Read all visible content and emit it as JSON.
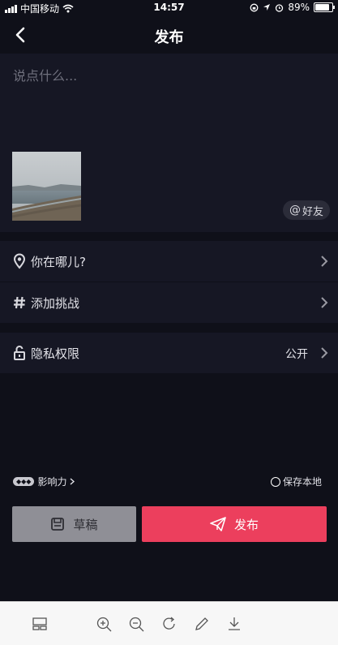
{
  "status_bar": {
    "carrier": "中国移动",
    "time": "14:57",
    "battery": "89%"
  },
  "header": {
    "title": "发布"
  },
  "compose": {
    "placeholder": "说点什么...",
    "mention_label": "好友"
  },
  "options": {
    "location_label": "你在哪儿?",
    "challenge_label": "添加挑战",
    "privacy_label": "隐私权限",
    "privacy_value": "公开"
  },
  "footer_links": {
    "influence_label": "影响力",
    "save_local_label": "保存本地"
  },
  "actions": {
    "draft_label": "草稿",
    "publish_label": "发布"
  },
  "colors": {
    "background": "#0f1019",
    "panel": "#161724",
    "publish_button": "#ec3f5d",
    "draft_button": "#8f8f96"
  },
  "toolbar_icons": [
    "layout-icon",
    "zoom-in-icon",
    "zoom-out-icon",
    "rotate-icon",
    "pencil-icon",
    "download-icon"
  ]
}
